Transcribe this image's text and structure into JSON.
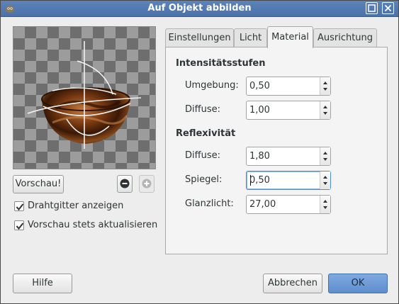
{
  "window": {
    "title": "Auf Objekt abbilden",
    "icons": {
      "app": "gimp-icon",
      "maximize": "maximize-icon",
      "close": "close-icon"
    }
  },
  "preview": {
    "button_label": "Vorschau!",
    "zoom_out_icon": "zoom-out-icon",
    "zoom_in_icon": "zoom-in-icon",
    "checkboxes": [
      {
        "label": "Drahtgitter anzeigen",
        "checked": true
      },
      {
        "label": "Vorschau stets aktualisieren",
        "checked": true
      }
    ]
  },
  "tabs": [
    {
      "label": "Einstellungen",
      "active": false
    },
    {
      "label": "Licht",
      "active": false
    },
    {
      "label": "Material",
      "active": true
    },
    {
      "label": "Ausrichtung",
      "active": false
    }
  ],
  "material": {
    "intensity": {
      "title": "Intensitätsstufen",
      "fields": [
        {
          "label": "Umgebung:",
          "value": "0,50"
        },
        {
          "label": "Diffuse:",
          "value": "1,00"
        }
      ]
    },
    "reflectivity": {
      "title": "Reflexivität",
      "fields": [
        {
          "label": "Diffuse:",
          "value": "1,80"
        },
        {
          "label": "Spiegel:",
          "value": "0,50",
          "focused": true
        },
        {
          "label": "Glanzlicht:",
          "value": "27,00"
        }
      ]
    }
  },
  "footer": {
    "help_label": "Hilfe",
    "cancel_label": "Abbrechen",
    "ok_label": "OK"
  },
  "colors": {
    "titlebar": "#4f76ad",
    "ok_button": "#6b99d6",
    "focus_ring": "#4a90d9"
  }
}
